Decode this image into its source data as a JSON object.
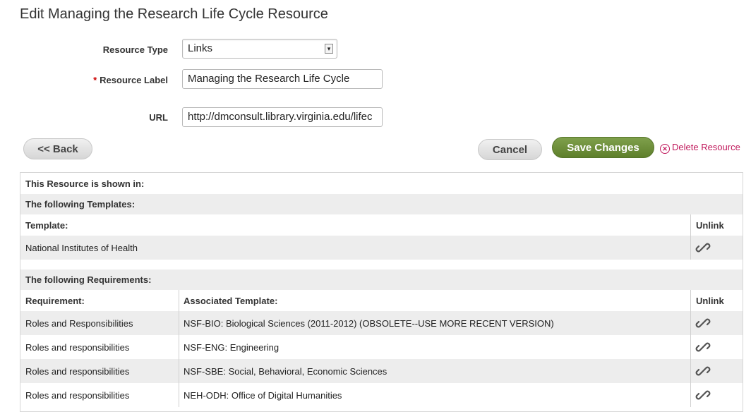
{
  "page": {
    "title": "Edit Managing the Research Life Cycle Resource"
  },
  "form": {
    "resource_type_label": "Resource Type",
    "resource_type_value": "Links",
    "resource_label_required": "*",
    "resource_label_label": "Resource Label",
    "resource_label_value": "Managing the Research Life Cycle",
    "url_label": "URL",
    "url_value": "http://dmconsult.library.virginia.edu/lifec"
  },
  "buttons": {
    "back": "<< Back",
    "cancel": "Cancel",
    "save": "Save Changes",
    "delete": "Delete Resource"
  },
  "panel": {
    "heading": "This Resource is shown in:",
    "templates_heading": "The following Templates:",
    "template_col": "Template:",
    "unlink_col": "Unlink",
    "templates": [
      {
        "name": "National Institutes of Health"
      }
    ],
    "requirements_heading": "The following Requirements:",
    "requirement_col": "Requirement:",
    "associated_col": "Associated Template:",
    "requirements": [
      {
        "requirement": "Roles and Responsibilities",
        "template": "NSF-BIO: Biological Sciences (2011-2012) (OBSOLETE--USE MORE RECENT VERSION)"
      },
      {
        "requirement": "Roles and responsibilities",
        "template": "NSF-ENG: Engineering"
      },
      {
        "requirement": "Roles and responsibilities",
        "template": "NSF-SBE: Social, Behavioral, Economic Sciences"
      },
      {
        "requirement": "Roles and responsibilities",
        "template": "NEH-ODH: Office of Digital Humanities"
      }
    ]
  },
  "colors": {
    "accent_green": "#6a8a36",
    "delete_red": "#c0185b"
  },
  "icons": {
    "unlink": "chain-link-icon",
    "delete": "circle-x-icon",
    "select": "dropdown-arrow-icon"
  }
}
